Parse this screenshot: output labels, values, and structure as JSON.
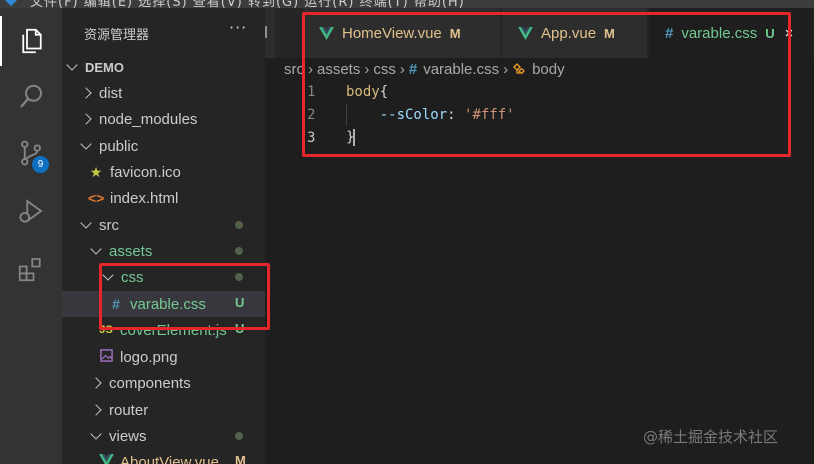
{
  "titlebar": {
    "menu_text": "文件(F)  编辑(E)  选择(S)  查看(V)  转到(G)  运行(R)  终端(T)  帮助(H)"
  },
  "activity_bar": {
    "items": [
      {
        "icon": "files-icon",
        "active": true
      },
      {
        "icon": "search-icon"
      },
      {
        "icon": "source-control-icon",
        "badge": "9"
      },
      {
        "icon": "run-debug-icon"
      },
      {
        "icon": "extensions-icon"
      }
    ]
  },
  "sidebar": {
    "title": "资源管理器",
    "more": "···",
    "root": "DEMO",
    "items": [
      {
        "label": "dist",
        "type": "folder",
        "expanded": false
      },
      {
        "label": "node_modules",
        "type": "folder",
        "expanded": false
      },
      {
        "label": "public",
        "type": "folder",
        "expanded": true
      },
      {
        "label": "favicon.ico",
        "type": "file",
        "icon": "star-icon"
      },
      {
        "label": "index.html",
        "type": "file",
        "icon": "html-icon"
      },
      {
        "label": "src",
        "type": "folder",
        "expanded": true,
        "status": "dot"
      },
      {
        "label": "assets",
        "type": "folder",
        "expanded": true,
        "status": "dot"
      },
      {
        "label": "css",
        "type": "folder",
        "expanded": true,
        "status": "dot"
      },
      {
        "label": "varable.css",
        "type": "file",
        "icon": "css-hash-icon",
        "status": "U",
        "selected": true
      },
      {
        "label": "coverElement.js",
        "type": "file",
        "icon": "js-icon",
        "status": "U"
      },
      {
        "label": "logo.png",
        "type": "file",
        "icon": "image-icon"
      },
      {
        "label": "components",
        "type": "folder",
        "expanded": false
      },
      {
        "label": "router",
        "type": "folder",
        "expanded": false
      },
      {
        "label": "views",
        "type": "folder",
        "expanded": true,
        "status": "dot"
      },
      {
        "label": "AboutView.vue",
        "type": "file",
        "icon": "vue-icon",
        "status": "M"
      }
    ]
  },
  "tabs": [
    {
      "label": "HomeView.vue",
      "flag": "M",
      "icon": "vue-icon"
    },
    {
      "label": "App.vue",
      "flag": "M",
      "icon": "vue-icon"
    },
    {
      "label": "varable.css",
      "flag": "U",
      "icon": "css-hash-icon",
      "active": true,
      "close": "×"
    }
  ],
  "breadcrumb": {
    "parts": [
      "src",
      "assets",
      "css",
      "varable.css",
      "body"
    ],
    "separator": "›",
    "hash": "#"
  },
  "code": {
    "lines": [
      {
        "num": "1",
        "parts": [
          {
            "t": "body",
            "c": "sel"
          },
          {
            "t": "{",
            "c": "brace"
          }
        ]
      },
      {
        "num": "2",
        "parts": [
          {
            "t": "    --sColor",
            "c": "prop"
          },
          {
            "t": ": ",
            "c": "punc"
          },
          {
            "t": "'#fff'",
            "c": "str"
          }
        ]
      },
      {
        "num": "3",
        "parts": [
          {
            "t": "}",
            "c": "brace"
          }
        ],
        "current": true
      }
    ]
  },
  "watermark": "@稀土掘金技术社区",
  "colors": {
    "annotation_red": "#e5262b",
    "untracked_green": "#73c991",
    "modified_amber": "#e2c08d",
    "vue_green": "#41b883",
    "css_blue": "#519aba"
  }
}
